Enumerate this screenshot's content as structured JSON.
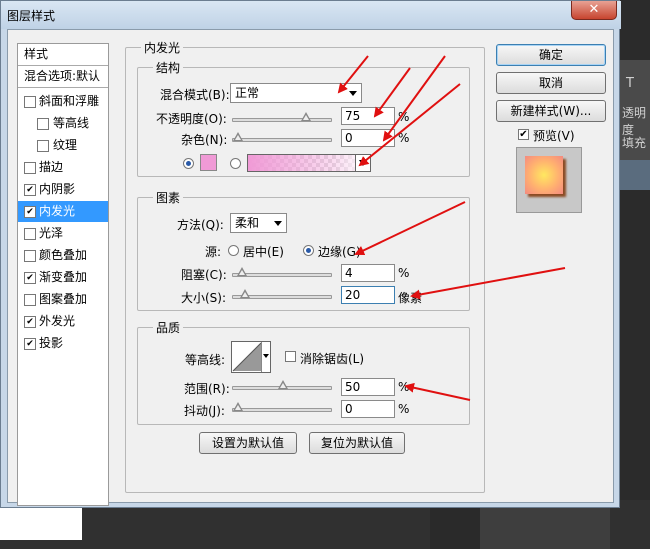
{
  "background": {
    "right_texts": [
      "T",
      "透明度",
      "填充"
    ]
  },
  "dialog": {
    "title": "图层样式",
    "close_glyph": "✕"
  },
  "style_list": {
    "header": "样式",
    "blend_default": "混合选项:默认",
    "items": [
      {
        "label": "斜面和浮雕",
        "checked": false,
        "selected": false,
        "indent": false
      },
      {
        "label": "等高线",
        "checked": false,
        "selected": false,
        "indent": true
      },
      {
        "label": "纹理",
        "checked": false,
        "selected": false,
        "indent": true
      },
      {
        "label": "描边",
        "checked": false,
        "selected": false,
        "indent": false
      },
      {
        "label": "内阴影",
        "checked": true,
        "selected": false,
        "indent": false
      },
      {
        "label": "内发光",
        "checked": true,
        "selected": true,
        "indent": false
      },
      {
        "label": "光泽",
        "checked": false,
        "selected": false,
        "indent": false
      },
      {
        "label": "颜色叠加",
        "checked": false,
        "selected": false,
        "indent": false
      },
      {
        "label": "渐变叠加",
        "checked": true,
        "selected": false,
        "indent": false
      },
      {
        "label": "图案叠加",
        "checked": false,
        "selected": false,
        "indent": false
      },
      {
        "label": "外发光",
        "checked": true,
        "selected": false,
        "indent": false
      },
      {
        "label": "投影",
        "checked": true,
        "selected": false,
        "indent": false
      }
    ]
  },
  "panel": {
    "title": "内发光",
    "structure": {
      "title": "结构",
      "blend_mode_label": "混合模式(B):",
      "blend_mode_value": "正常",
      "opacity_label": "不透明度(O):",
      "opacity_value": "75",
      "opacity_unit": "%",
      "opacity_level": 75,
      "noise_label": "杂色(N):",
      "noise_value": "0",
      "noise_unit": "%",
      "noise_level": 0
    },
    "elements": {
      "title": "图素",
      "method_label": "方法(Q):",
      "method_value": "柔和",
      "source_label": "源:",
      "center_label": "居中(E)",
      "edge_label": "边缘(G)",
      "choke_label": "阻塞(C):",
      "choke_value": "4",
      "choke_unit": "%",
      "choke_level": 4,
      "size_label": "大小(S):",
      "size_value": "20",
      "size_unit": "像素",
      "size_level": 8
    },
    "quality": {
      "title": "品质",
      "contour_label": "等高线:",
      "antialias_label": "消除锯齿(L)",
      "range_label": "范围(R):",
      "range_value": "50",
      "range_unit": "%",
      "range_level": 50,
      "jitter_label": "抖动(J):",
      "jitter_value": "0",
      "jitter_unit": "%",
      "jitter_level": 0
    },
    "make_default": "设置为默认值",
    "reset_default": "复位为默认值"
  },
  "right_buttons": {
    "ok": "确定",
    "cancel": "取消",
    "new_style": "新建样式(W)...",
    "preview_label": "预览(V)"
  },
  "colors": {
    "glow_color": "#f09ad6",
    "selection": "#3399ff",
    "arrow": "#e01010"
  }
}
